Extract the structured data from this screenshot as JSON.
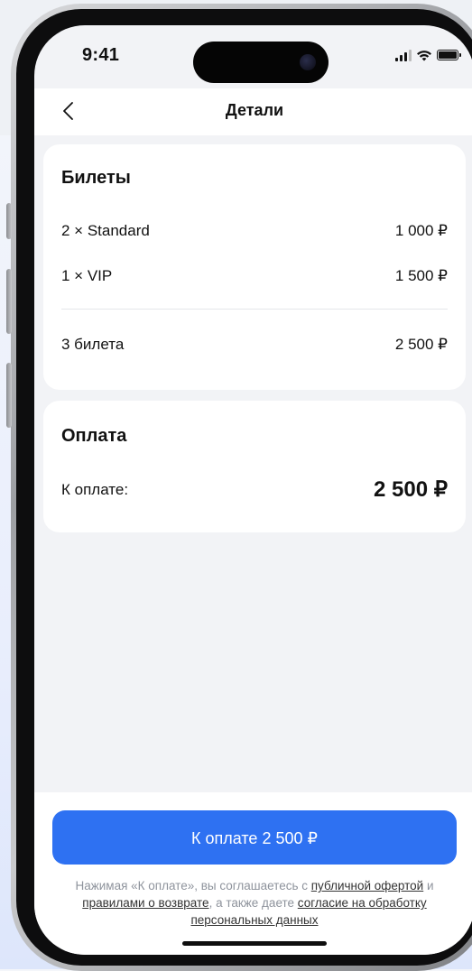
{
  "status_bar": {
    "time": "9:41"
  },
  "nav": {
    "title": "Детали"
  },
  "tickets": {
    "title": "Билеты",
    "items": [
      {
        "label": "2 × Standard",
        "price": "1 000 ₽"
      },
      {
        "label": "1 × VIP",
        "price": "1 500 ₽"
      }
    ],
    "summary_label": "3 билета",
    "summary_price": "2 500 ₽"
  },
  "payment": {
    "title": "Оплата",
    "due_label": "К оплате:",
    "due_amount": "2 500 ₽"
  },
  "bottom": {
    "pay_button_label": "К оплате 2 500 ₽",
    "legal": {
      "part1": "Нажимая «К оплате», вы соглашаетесь с ",
      "link_offer": "публичной офертой",
      "part2": " и ",
      "link_refund": "правилами о возврате",
      "part3": ", а также даете ",
      "link_consent": "согласие на обработку персональных данных"
    }
  },
  "colors": {
    "accent": "#2e71f2",
    "card": "#ffffff",
    "screen_bg": "#f2f3f6"
  },
  "icons": {
    "back": "chevron-left-icon",
    "signal": "cellular-signal-icon",
    "wifi": "wifi-icon",
    "battery": "battery-icon"
  }
}
